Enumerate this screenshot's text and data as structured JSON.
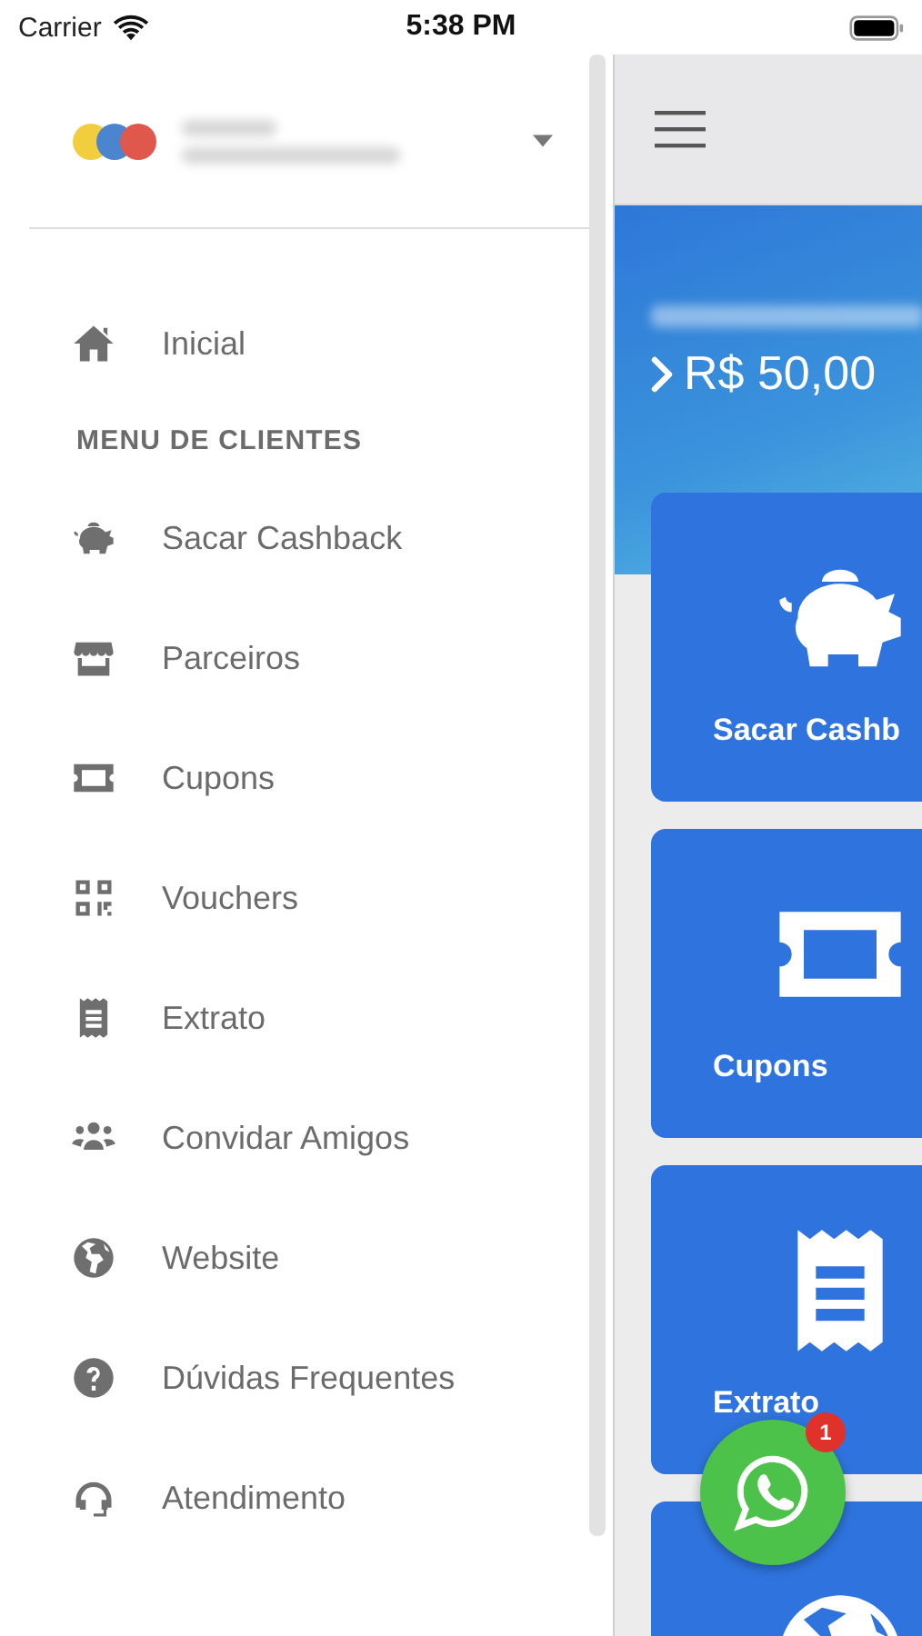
{
  "status_bar": {
    "carrier": "Carrier",
    "time": "5:38 PM"
  },
  "drawer": {
    "home_item": {
      "label": "Inicial"
    },
    "section_title": "MENU DE CLIENTES",
    "items": [
      {
        "label": "Sacar Cashback"
      },
      {
        "label": "Parceiros"
      },
      {
        "label": "Cupons"
      },
      {
        "label": "Vouchers"
      },
      {
        "label": "Extrato"
      },
      {
        "label": "Convidar Amigos"
      },
      {
        "label": "Website"
      },
      {
        "label": "Dúvidas Frequentes"
      },
      {
        "label": "Atendimento"
      }
    ]
  },
  "main": {
    "balance": "R$ 50,00",
    "cards": [
      {
        "kind": "labeled",
        "label": "Sacar Cashb"
      },
      {
        "kind": "labeled",
        "label": "Cupons"
      },
      {
        "kind": "labeled",
        "label": "Extrato"
      },
      {
        "kind": "icon_only"
      }
    ]
  },
  "whatsapp": {
    "badge": "1"
  }
}
